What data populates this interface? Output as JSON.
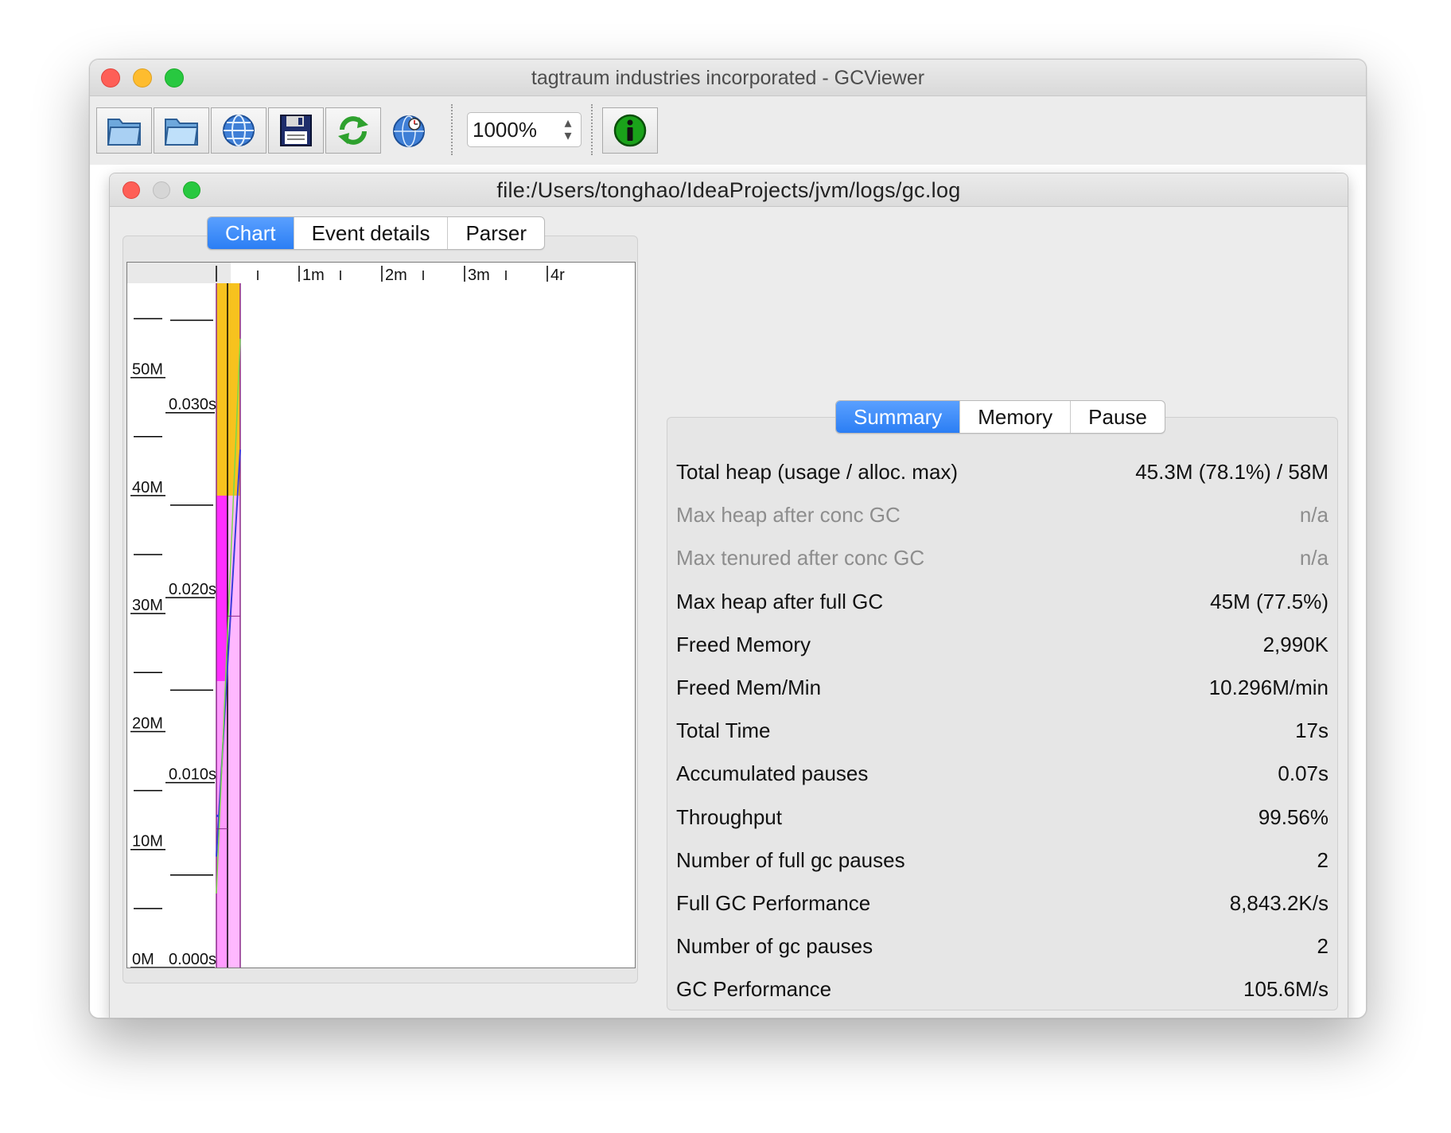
{
  "window": {
    "title": "tagtraum industries incorporated - GCViewer"
  },
  "toolbar": {
    "buttons": [
      {
        "name": "open-file-icon"
      },
      {
        "name": "open-folder-icon"
      },
      {
        "name": "open-url-icon"
      },
      {
        "name": "save-icon"
      },
      {
        "name": "refresh-icon"
      },
      {
        "name": "watch-icon"
      }
    ],
    "zoom_value": "1000%",
    "info_button": {
      "name": "info-icon"
    }
  },
  "document": {
    "title": "file:/Users/tonghao/IdeaProjects/jvm/logs/gc.log"
  },
  "chart_tabs": [
    {
      "label": "Chart",
      "active": true
    },
    {
      "label": "Event details",
      "active": false
    },
    {
      "label": "Parser",
      "active": false
    }
  ],
  "chart_data": {
    "type": "area",
    "x_axis_ticks": [
      "1m",
      "2m",
      "3m",
      "4r"
    ],
    "memory_axis_ticks": [
      "50M",
      "40M",
      "30M",
      "20M",
      "10M",
      "0M"
    ],
    "pause_axis_ticks": [
      "0.030s",
      "0.020s",
      "0.010s",
      "0.000s"
    ],
    "memory_ylim": [
      0,
      58
    ],
    "pause_ylim": [
      0,
      0.037
    ],
    "colors": {
      "total_heap": "#f7c21e",
      "used_heap": "#ff2eff",
      "tenured": "#ffb8ff",
      "gc_line": "#3b3bd9",
      "full_gc_line": "#7bd94a"
    },
    "series": [
      {
        "type": "area",
        "values_mb": [
          58,
          58
        ],
        "color": "#f7c21e"
      },
      {
        "type": "area",
        "values_mb": [
          40,
          40
        ],
        "color": "#ff2eff"
      }
    ]
  },
  "summary_tabs": [
    {
      "label": "Summary",
      "active": true
    },
    {
      "label": "Memory",
      "active": false
    },
    {
      "label": "Pause",
      "active": false
    }
  ],
  "summary": [
    {
      "label": "Total heap (usage / alloc. max)",
      "value": "45.3M (78.1%) / 58M",
      "dim": false
    },
    {
      "label": "Max heap after conc GC",
      "value": "n/a",
      "dim": true
    },
    {
      "label": "Max tenured after conc GC",
      "value": "n/a",
      "dim": true
    },
    {
      "label": "Max heap after full GC",
      "value": "45M (77.5%)",
      "dim": false
    },
    {
      "label": "Freed Memory",
      "value": "2,990K",
      "dim": false
    },
    {
      "label": "Freed Mem/Min",
      "value": "10.296M/min",
      "dim": false
    },
    {
      "label": "Total Time",
      "value": "17s",
      "dim": false
    },
    {
      "label": "Accumulated pauses",
      "value": "0.07s",
      "dim": false
    },
    {
      "label": "Throughput",
      "value": "99.56%",
      "dim": false
    },
    {
      "label": "Number of full gc pauses",
      "value": "2",
      "dim": false
    },
    {
      "label": "Full GC Performance",
      "value": "8,843.2K/s",
      "dim": false
    },
    {
      "label": "Number of gc pauses",
      "value": "2",
      "dim": false
    },
    {
      "label": "GC Performance",
      "value": "105.6M/s",
      "dim": false
    }
  ]
}
